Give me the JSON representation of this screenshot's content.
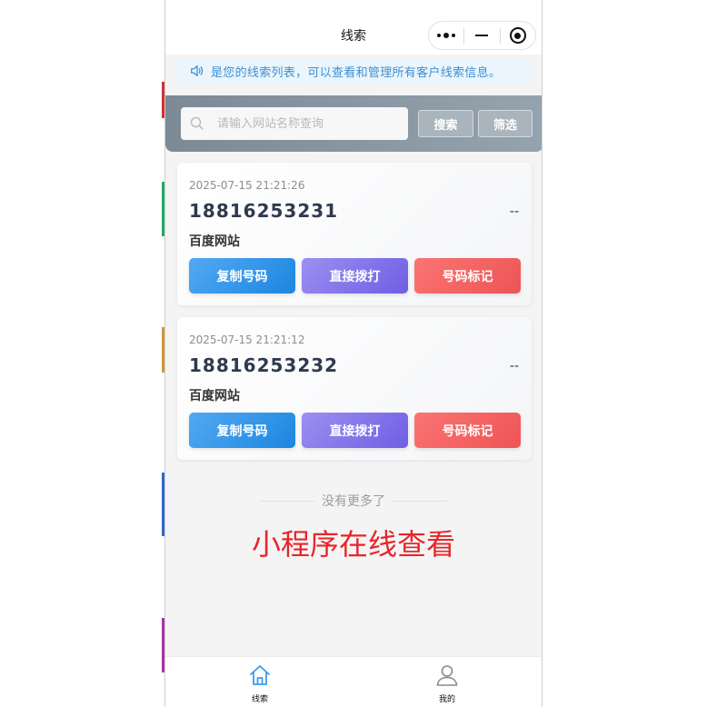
{
  "nav": {
    "title": "线索"
  },
  "notice": {
    "text": "是您的线索列表，可以查看和管理所有客户线索信息。"
  },
  "search": {
    "placeholder": "请输入网站名称查询",
    "search_label": "搜索",
    "filter_label": "筛选"
  },
  "leads": [
    {
      "time": "2025-07-15 21:21:26",
      "phone": "18816253231",
      "status": "--",
      "site": "百度网站",
      "copy_label": "复制号码",
      "call_label": "直接拨打",
      "mark_label": "号码标记"
    },
    {
      "time": "2025-07-15 21:21:12",
      "phone": "18816253232",
      "status": "--",
      "site": "百度网站",
      "copy_label": "复制号码",
      "call_label": "直接拨打",
      "mark_label": "号码标记"
    }
  ],
  "list_end": "没有更多了",
  "promo": "小程序在线查看",
  "tabbar": {
    "tabs": [
      {
        "label": "线索",
        "icon": "home-icon",
        "active": true
      },
      {
        "label": "我的",
        "icon": "user-icon",
        "active": false
      }
    ]
  },
  "colors": {
    "accent_blue": "#1c86e0",
    "accent_purple": "#6f5ee3",
    "accent_red": "#ee5454",
    "promo_red": "#e6262b",
    "notice_text": "#3f8fd0"
  }
}
